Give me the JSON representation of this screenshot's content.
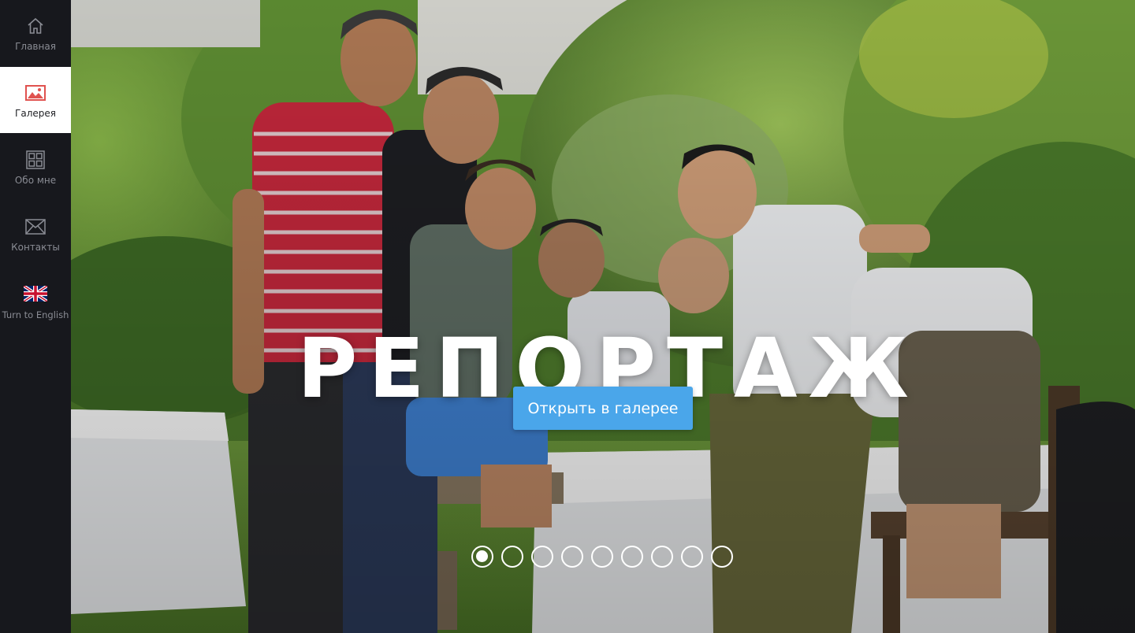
{
  "sidebar": {
    "items": [
      {
        "label": "Главная",
        "icon": "home-icon"
      },
      {
        "label": "Галерея",
        "icon": "image-icon",
        "active": true
      },
      {
        "label": "Обо мне",
        "icon": "grid-icon"
      },
      {
        "label": "Контакты",
        "icon": "mail-icon"
      },
      {
        "label": "Turn to English",
        "icon": "uk-flag-icon"
      }
    ]
  },
  "hero": {
    "title": "РЕПОРТАЖ",
    "cta_label": "Открыть в галерее",
    "slides_count": 9,
    "active_slide": 1
  },
  "colors": {
    "sidebar_bg": "#17181d",
    "accent": "#4aa6ea",
    "active_item_bg": "#ffffff",
    "icon_active": "#e0524f"
  }
}
